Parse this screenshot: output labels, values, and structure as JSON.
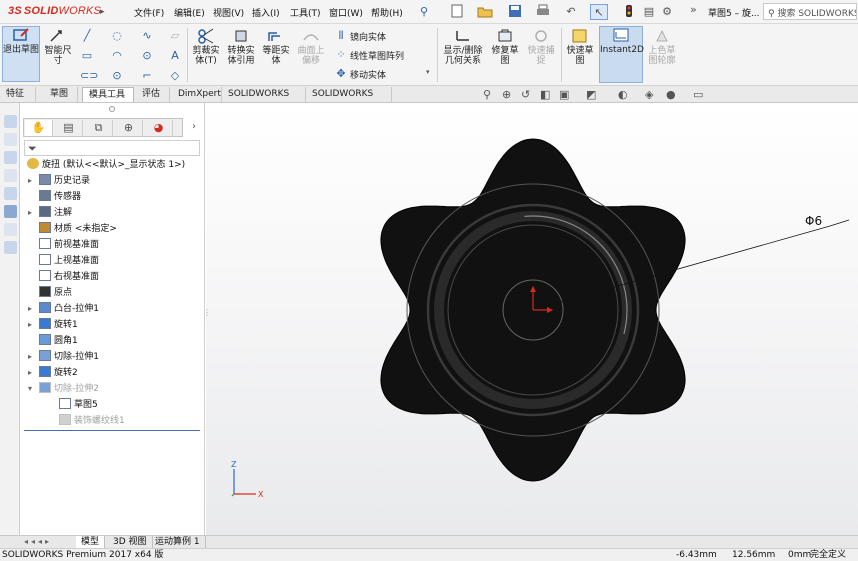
{
  "app": {
    "logo_prefix": "3S",
    "logo_solid": "SOLID",
    "logo_works": "WORKS",
    "doc_title": "草图5 – 旋...",
    "search_placeholder": "搜索 SOLIDWORKS",
    "brand_color": "#d52b1e"
  },
  "menu": [
    {
      "label": "文件(F)"
    },
    {
      "label": "编辑(E)"
    },
    {
      "label": "视图(V)"
    },
    {
      "label": "插入(I)"
    },
    {
      "label": "工具(T)"
    },
    {
      "label": "窗口(W)"
    },
    {
      "label": "帮助(H)"
    }
  ],
  "ribbon": {
    "exit_sketch": "退出草图",
    "smart_dim": "智能尺寸",
    "trim": "剪裁实体(T)",
    "convert": "转换实体引用",
    "offset": "等距实体",
    "surface_offset": "曲面上偏移",
    "mirror": "镜向实体",
    "linear_pattern": "线性草图阵列",
    "move": "移动实体",
    "show_delete_rel": "显示/删除几何关系",
    "repair": "修复草图",
    "quick_snap": "快速捕捉",
    "quick_sketch": "快速草图",
    "instant2d": "Instant2D",
    "shaded_contours": "上色草图轮廓"
  },
  "tabs": [
    {
      "label": "特征",
      "active": false
    },
    {
      "label": "草图",
      "active": false
    },
    {
      "label": "模具工具",
      "active": true
    },
    {
      "label": "评估",
      "active": false
    },
    {
      "label": "DimXpert",
      "active": false
    },
    {
      "label": "SOLIDWORKS 插件",
      "active": false
    },
    {
      "label": "SOLIDWORKS MBD",
      "active": false
    }
  ],
  "tree": {
    "root": "旋扭 (默认<<默认>_显示状态 1>)",
    "items": [
      {
        "label": "历史记录",
        "arrow": "▸",
        "icon": "history-icon"
      },
      {
        "label": "传感器",
        "arrow": "",
        "icon": "sensor-icon"
      },
      {
        "label": "注解",
        "arrow": "▸",
        "icon": "annotation-icon"
      },
      {
        "label": "材质 <未指定>",
        "arrow": "",
        "icon": "material-icon"
      },
      {
        "label": "前视基准面",
        "arrow": "",
        "icon": "plane-icon"
      },
      {
        "label": "上视基准面",
        "arrow": "",
        "icon": "plane-icon"
      },
      {
        "label": "右视基准面",
        "arrow": "",
        "icon": "plane-icon"
      },
      {
        "label": "原点",
        "arrow": "",
        "icon": "origin-icon"
      },
      {
        "label": "凸台-拉伸1",
        "arrow": "▸",
        "icon": "extrude-icon"
      },
      {
        "label": "旋转1",
        "arrow": "▸",
        "icon": "revolve-icon"
      },
      {
        "label": "圆角1",
        "arrow": "",
        "icon": "fillet-icon"
      },
      {
        "label": "切除-拉伸1",
        "arrow": "▸",
        "icon": "cut-extrude-icon"
      },
      {
        "label": "旋转2",
        "arrow": "▸",
        "icon": "revolve-icon"
      },
      {
        "label": "切除-拉伸2",
        "arrow": "▾",
        "icon": "cut-extrude-icon",
        "grey": true
      },
      {
        "label": "草图5",
        "arrow": "",
        "icon": "sketch-icon",
        "child": true
      },
      {
        "label": "装饰螺纹线1",
        "arrow": "",
        "icon": "thread-icon",
        "child": true,
        "grey": true
      }
    ]
  },
  "viewport": {
    "dimension_label": "Φ6",
    "axis_x": "X",
    "axis_z": "Z",
    "part_color": "#111111"
  },
  "bottom_tabs": [
    {
      "label": "模型",
      "active": true
    },
    {
      "label": "3D 视图",
      "active": false
    },
    {
      "label": "运动算例 1",
      "active": false
    }
  ],
  "status": {
    "product": "SOLIDWORKS Premium 2017 x64 版",
    "x": "-6.43mm",
    "y": "12.56mm",
    "z": "0mm",
    "state": "完全定义"
  }
}
